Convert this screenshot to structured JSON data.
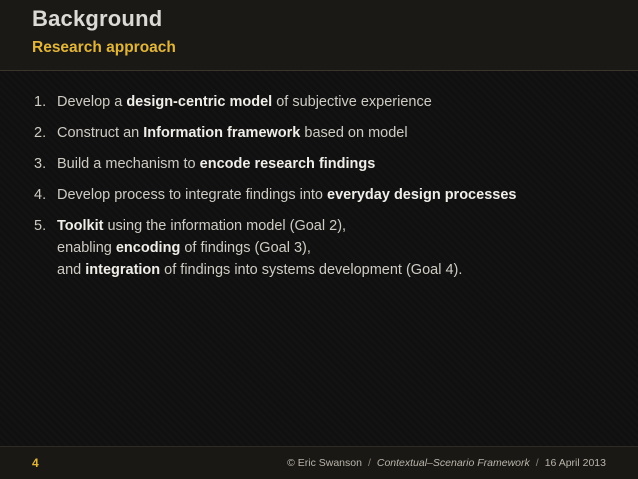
{
  "header": {
    "title": "Background",
    "subtitle": "Research approach"
  },
  "items": [
    {
      "number": "1.",
      "lines": [
        [
          {
            "text": "Develop a ",
            "bold": false
          },
          {
            "text": "design-centric model",
            "bold": true
          },
          {
            "text": " of subjective experience",
            "bold": false
          }
        ]
      ]
    },
    {
      "number": "2.",
      "lines": [
        [
          {
            "text": "Construct an ",
            "bold": false
          },
          {
            "text": "Information framework",
            "bold": true
          },
          {
            "text": " based on model",
            "bold": false
          }
        ]
      ]
    },
    {
      "number": "3.",
      "lines": [
        [
          {
            "text": "Build a mechanism to ",
            "bold": false
          },
          {
            "text": "encode research findings",
            "bold": true
          }
        ]
      ]
    },
    {
      "number": "4.",
      "lines": [
        [
          {
            "text": "Develop process to integrate findings into ",
            "bold": false
          },
          {
            "text": "everyday design processes",
            "bold": true
          }
        ]
      ]
    },
    {
      "number": "5.",
      "lines": [
        [
          {
            "text": "Toolkit",
            "bold": true
          },
          {
            "text": " using the information model (Goal 2),",
            "bold": false
          }
        ],
        [
          {
            "text": "enabling ",
            "bold": false
          },
          {
            "text": "encoding",
            "bold": true
          },
          {
            "text": " of findings (Goal 3),",
            "bold": false
          }
        ],
        [
          {
            "text": "and ",
            "bold": false
          },
          {
            "text": "integration",
            "bold": true
          },
          {
            "text": " of findings into systems development (Goal 4).",
            "bold": false
          }
        ]
      ]
    }
  ],
  "footer": {
    "page_number": "4",
    "author": "© Eric Swanson",
    "separator": "/",
    "framework": "Contextual–Scenario Framework",
    "date": "16 April 2013"
  }
}
